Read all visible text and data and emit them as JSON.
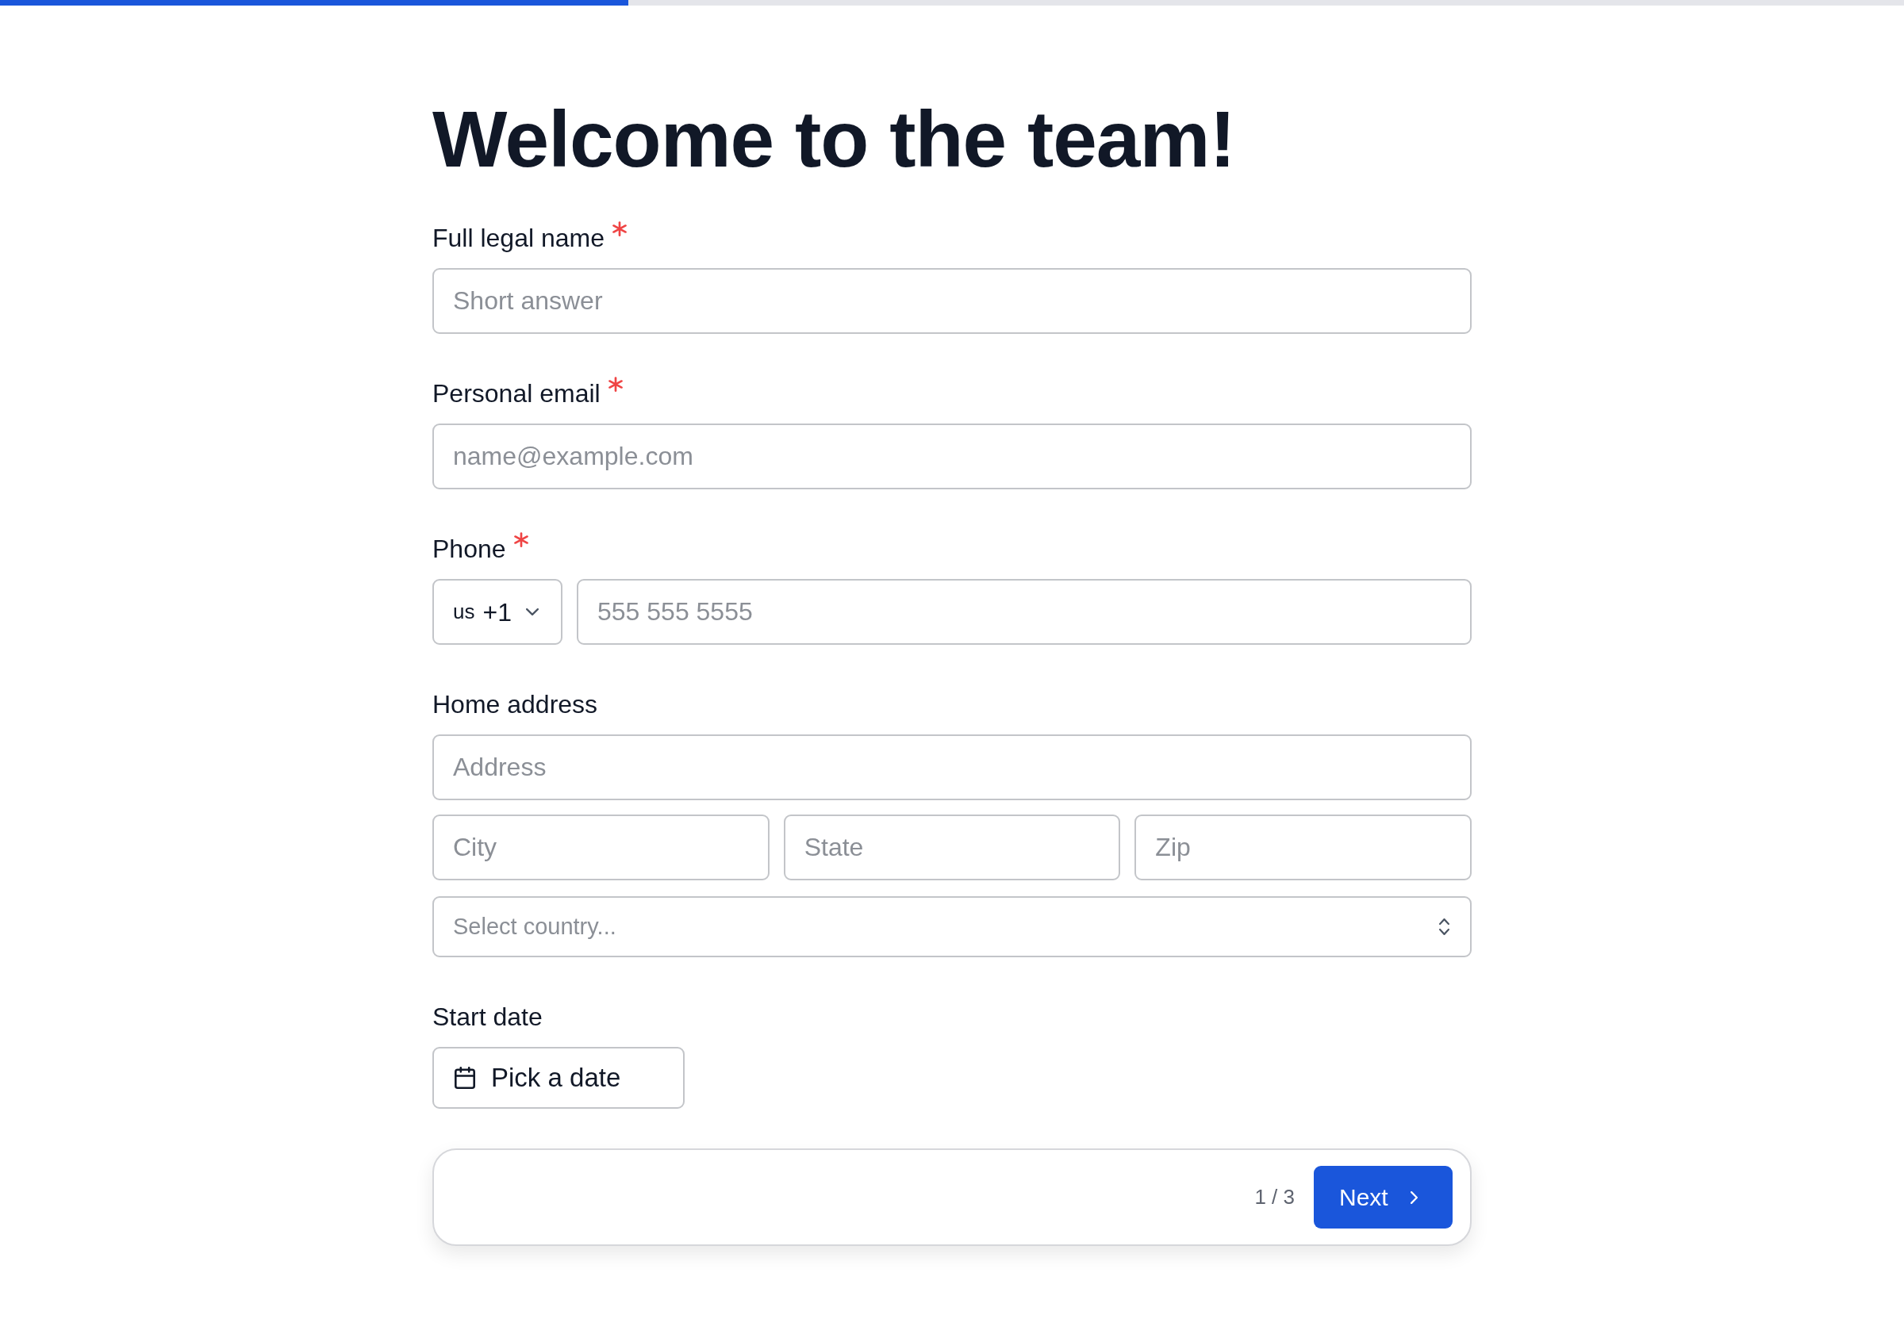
{
  "progress": {
    "level": 0.33
  },
  "title": "Welcome to the team!",
  "fields": [
    {
      "kind": "text",
      "label": "Full legal name",
      "required": true,
      "placeholder": "Short answer"
    },
    {
      "kind": "text",
      "label": "Personal email",
      "required": true,
      "placeholder": "name@example.com"
    },
    {
      "kind": "phone",
      "label": "Phone",
      "required": true,
      "country_code": {
        "region": "us",
        "dial_code": "+1"
      },
      "placeholder": "555 555 5555"
    },
    {
      "kind": "address",
      "label": "Home address",
      "required": false,
      "street": {
        "placeholder": "Address"
      },
      "parts": [
        {
          "placeholder": "City"
        },
        {
          "placeholder": "State"
        },
        {
          "placeholder": "Zip"
        }
      ],
      "country": {
        "placeholder": "Select country..."
      }
    },
    {
      "kind": "date",
      "label": "Start date",
      "required": false,
      "button": "Pick a date"
    }
  ],
  "footer": {
    "page_indicator": "1 / 3",
    "next_button": "Next"
  }
}
